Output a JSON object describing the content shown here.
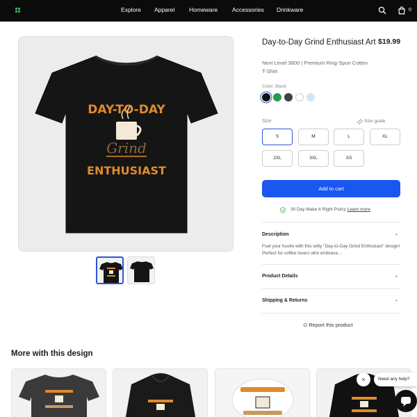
{
  "nav": {
    "items": [
      "Explore",
      "Apparel",
      "Homeware",
      "Accessories",
      "Drinkware"
    ],
    "cart_count": "0"
  },
  "product": {
    "title": "Day-to-Day Grind Enthusiast Art",
    "price": "$19.99",
    "subtitle": "Next Level 3600 | Premium Ring-Spun Cotton T-Shirt",
    "color_label": "Color: Black",
    "colors": [
      "#111111",
      "#2a9a4b",
      "#3e4048",
      "#ffffff",
      "#cfe6f5"
    ],
    "design_text": [
      "DAY-TO-DAY",
      "Grind",
      "ENTHUSIAST"
    ],
    "size_label": "Size",
    "size_guide": "Size guide",
    "sizes": [
      "S",
      "M",
      "L",
      "XL",
      "2XL",
      "3XL",
      "XS"
    ],
    "selected_size": "S",
    "add_to_cart": "Add to cart",
    "policy_text": "30 Day Make It Right Policy",
    "learn_more": "Learn more"
  },
  "accordion": {
    "description_title": "Description",
    "description_text": "Fuel your hustle with this witty \"Day-to-Day Grind Enthusiast\" design! Perfect for coffee lovers who embrace...",
    "details_title": "Product Details",
    "shipping_title": "Shipping & Returns",
    "plus": "+"
  },
  "report": "⊙ Report this product",
  "more": {
    "title": "More with this design"
  },
  "help": {
    "close": "×",
    "text": "Need any help?"
  },
  "colors": {
    "accent": "#1a56f0",
    "selected_border": "#2b55d6",
    "nav_bg": "#0b0b0b",
    "design_orange": "#e08a2e"
  }
}
